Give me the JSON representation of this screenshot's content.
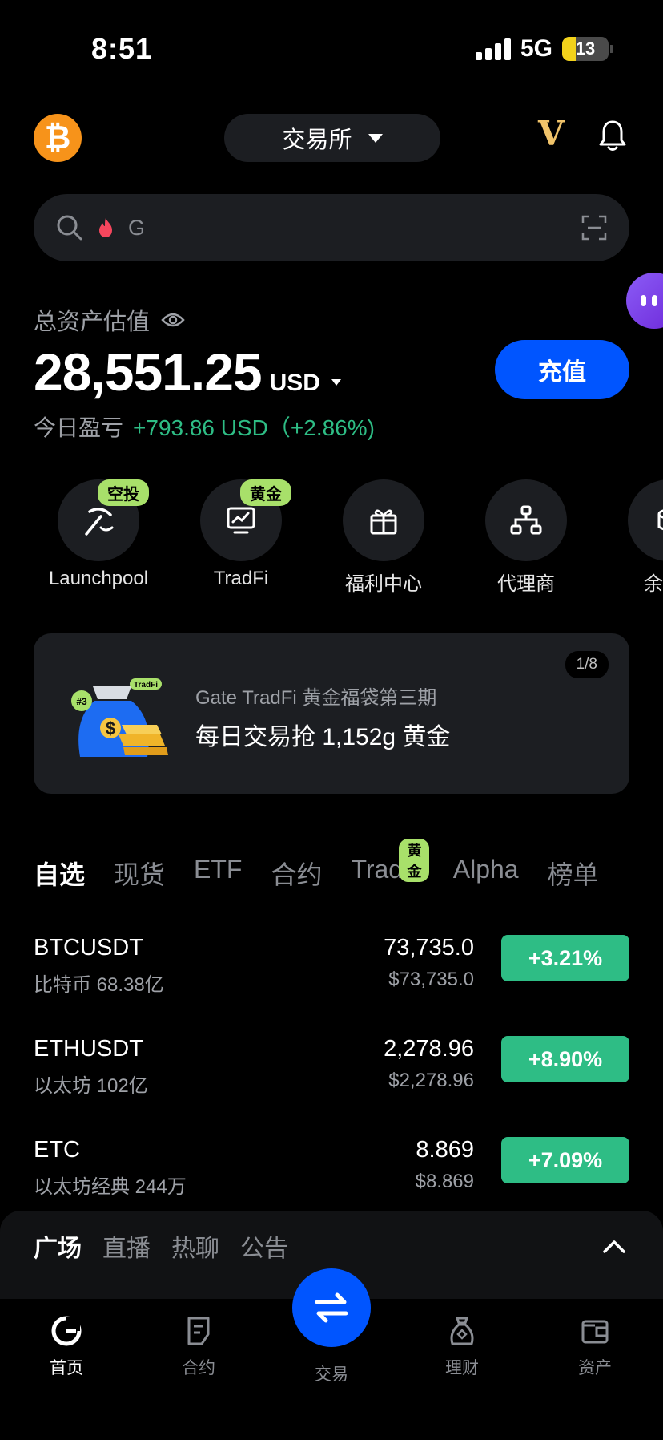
{
  "status_bar": {
    "time": "8:51",
    "network": "5G",
    "battery": "13"
  },
  "header": {
    "exchange_label": "交易所",
    "vip_label": "V"
  },
  "search": {
    "placeholder": "G"
  },
  "assets": {
    "label": "总资产估值",
    "value": "28,551.25",
    "currency": "USD",
    "pnl_label": "今日盈亏",
    "pnl_value": "+793.86 USD（+2.86%)",
    "deposit_label": "充值"
  },
  "quick_actions": [
    {
      "label": "Launchpool",
      "tag": "空投",
      "icon": "pickaxe-icon"
    },
    {
      "label": "TradFi",
      "tag": "黄金",
      "icon": "chart-monitor-icon"
    },
    {
      "label": "福利中心",
      "tag": "",
      "icon": "gift-icon"
    },
    {
      "label": "代理商",
      "tag": "",
      "icon": "org-chart-icon"
    },
    {
      "label": "余",
      "tag": "",
      "icon": "coins-icon"
    }
  ],
  "banner": {
    "counter": "1/8",
    "subtitle": "Gate TradFi 黄金福袋第三期",
    "title": "每日交易抢 1,152g 黄金",
    "bag_rank": "#3",
    "bag_tag": "TradFi",
    "bag_symbol": "$"
  },
  "market_tabs": {
    "items": [
      "自选",
      "现货",
      "ETF",
      "合约",
      "TradFi",
      "Alpha",
      "榜单"
    ],
    "active": "自选",
    "tradfi_tag": "黄金"
  },
  "market_rows": [
    {
      "symbol": "BTCUSDT",
      "sub": "比特币 68.38亿",
      "price": "73,735.0",
      "usd": "$73,735.0",
      "change": "+3.21%"
    },
    {
      "symbol": "ETHUSDT",
      "sub": "以太坊 102亿",
      "price": "2,278.96",
      "usd": "$2,278.96",
      "change": "+8.90%"
    },
    {
      "symbol": "ETC",
      "sub": "以太坊经典 244万",
      "price": "8.869",
      "usd": "$8.869",
      "change": "+7.09%"
    }
  ],
  "square_tabs": {
    "items": [
      "广场",
      "直播",
      "热聊",
      "公告"
    ],
    "active": "广场"
  },
  "bottom_nav": {
    "items": [
      {
        "label": "首页",
        "icon": "home-icon",
        "active": true
      },
      {
        "label": "合约",
        "icon": "contract-icon",
        "active": false
      },
      {
        "label": "交易",
        "icon": "swap-icon",
        "active": false
      },
      {
        "label": "理财",
        "icon": "wealth-icon",
        "active": false
      },
      {
        "label": "资产",
        "icon": "wallet-icon",
        "active": false
      }
    ]
  },
  "colors": {
    "accent_blue": "#0055ff",
    "positive_green": "#2ebd85",
    "tag_green": "#a8e06a",
    "vip_gold": "#f0c36a",
    "bitcoin_orange": "#f7931a"
  }
}
